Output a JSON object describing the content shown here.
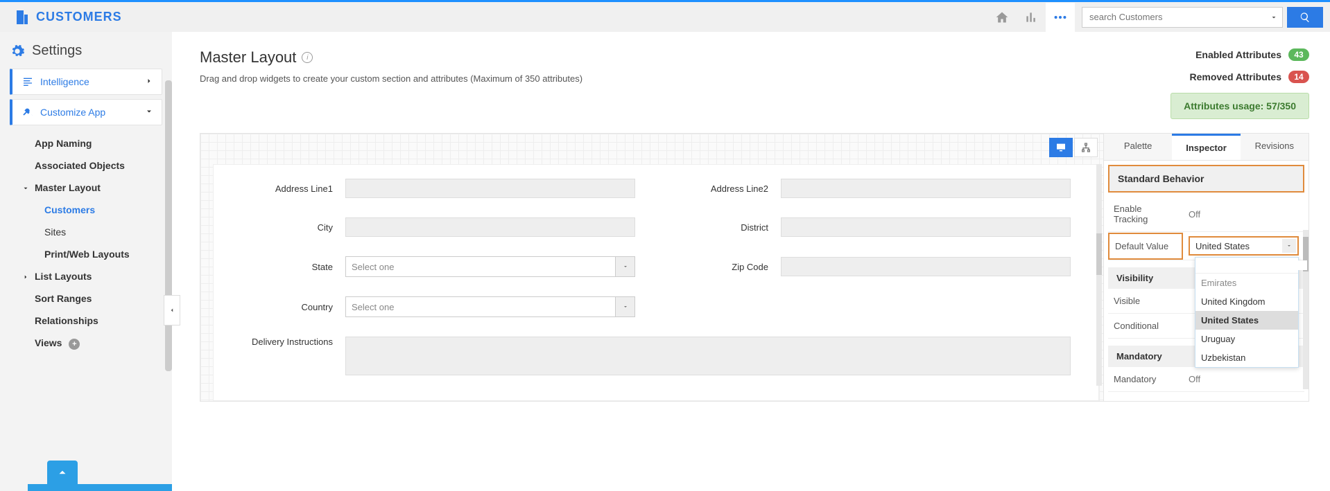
{
  "top": {
    "brand": "CUSTOMERS",
    "search_placeholder": "search Customers"
  },
  "sidebar": {
    "title": "Settings",
    "nav": [
      {
        "label": "Intelligence"
      },
      {
        "label": "Customize App"
      }
    ],
    "tree": {
      "app_naming": "App Naming",
      "associated_objects": "Associated Objects",
      "master_layout": "Master Layout",
      "customers": "Customers",
      "sites": "Sites",
      "print_web": "Print/Web Layouts",
      "list_layouts": "List Layouts",
      "sort_ranges": "Sort Ranges",
      "relationships": "Relationships",
      "views": "Views"
    }
  },
  "page": {
    "title": "Master Layout",
    "subtitle": "Drag and drop widgets to create your custom section and attributes (Maximum of 350 attributes)",
    "stats": {
      "enabled_label": "Enabled Attributes",
      "enabled_count": "43",
      "removed_label": "Removed Attributes",
      "removed_count": "14",
      "usage": "Attributes usage: 57/350"
    }
  },
  "form": {
    "address1": "Address Line1",
    "address2": "Address Line2",
    "city": "City",
    "district": "District",
    "state": "State",
    "zip": "Zip Code",
    "country": "Country",
    "delivery": "Delivery Instructions",
    "select_one": "Select one"
  },
  "inspector": {
    "tabs": {
      "palette": "Palette",
      "inspector": "Inspector",
      "revisions": "Revisions"
    },
    "section_head": "Standard Behavior",
    "enable_tracking": "Enable Tracking",
    "enable_tracking_val": "Off",
    "default_value": "Default Value",
    "default_value_val": "United States",
    "visibility_head": "Visibility",
    "visible": "Visible",
    "conditional": "Conditional",
    "mandatory_head": "Mandatory",
    "mandatory": "Mandatory",
    "mandatory_val": "Off",
    "dd_options": {
      "opt0": "Emirates",
      "opt1": "United Kingdom",
      "opt2": "United States",
      "opt3": "Uruguay",
      "opt4": "Uzbekistan"
    }
  }
}
